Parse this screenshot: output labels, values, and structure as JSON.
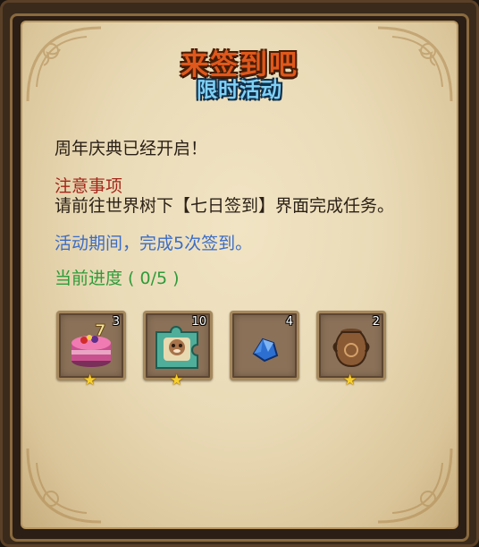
{
  "popup": {
    "title": "来签到吧",
    "subtitle": "限时活动",
    "announcement": "周年庆典已经开启！",
    "notice_heading": "注意事项",
    "notice_text": "请前往世界树下【七日签到】界面完成任务。",
    "activity_text": "活动期间，完成5次签到。",
    "progress_text": "当前进度 ( 0/5 )"
  },
  "rewards": [
    {
      "name": "cake-item-icon",
      "count": "3",
      "star": "★"
    },
    {
      "name": "puzzle-piece-item-icon",
      "count": "10",
      "star": "★"
    },
    {
      "name": "blue-crystal-item-icon",
      "count": "4",
      "star": ""
    },
    {
      "name": "ancient-urn-item-icon",
      "count": "2",
      "star": "★"
    }
  ],
  "colors": {
    "title": "#e0581c",
    "subtitle": "#7fd0f5",
    "notice": "#a4261a",
    "activity": "#3b6cc6",
    "progress": "#2f9b3a",
    "star": "#f7cf2a"
  }
}
